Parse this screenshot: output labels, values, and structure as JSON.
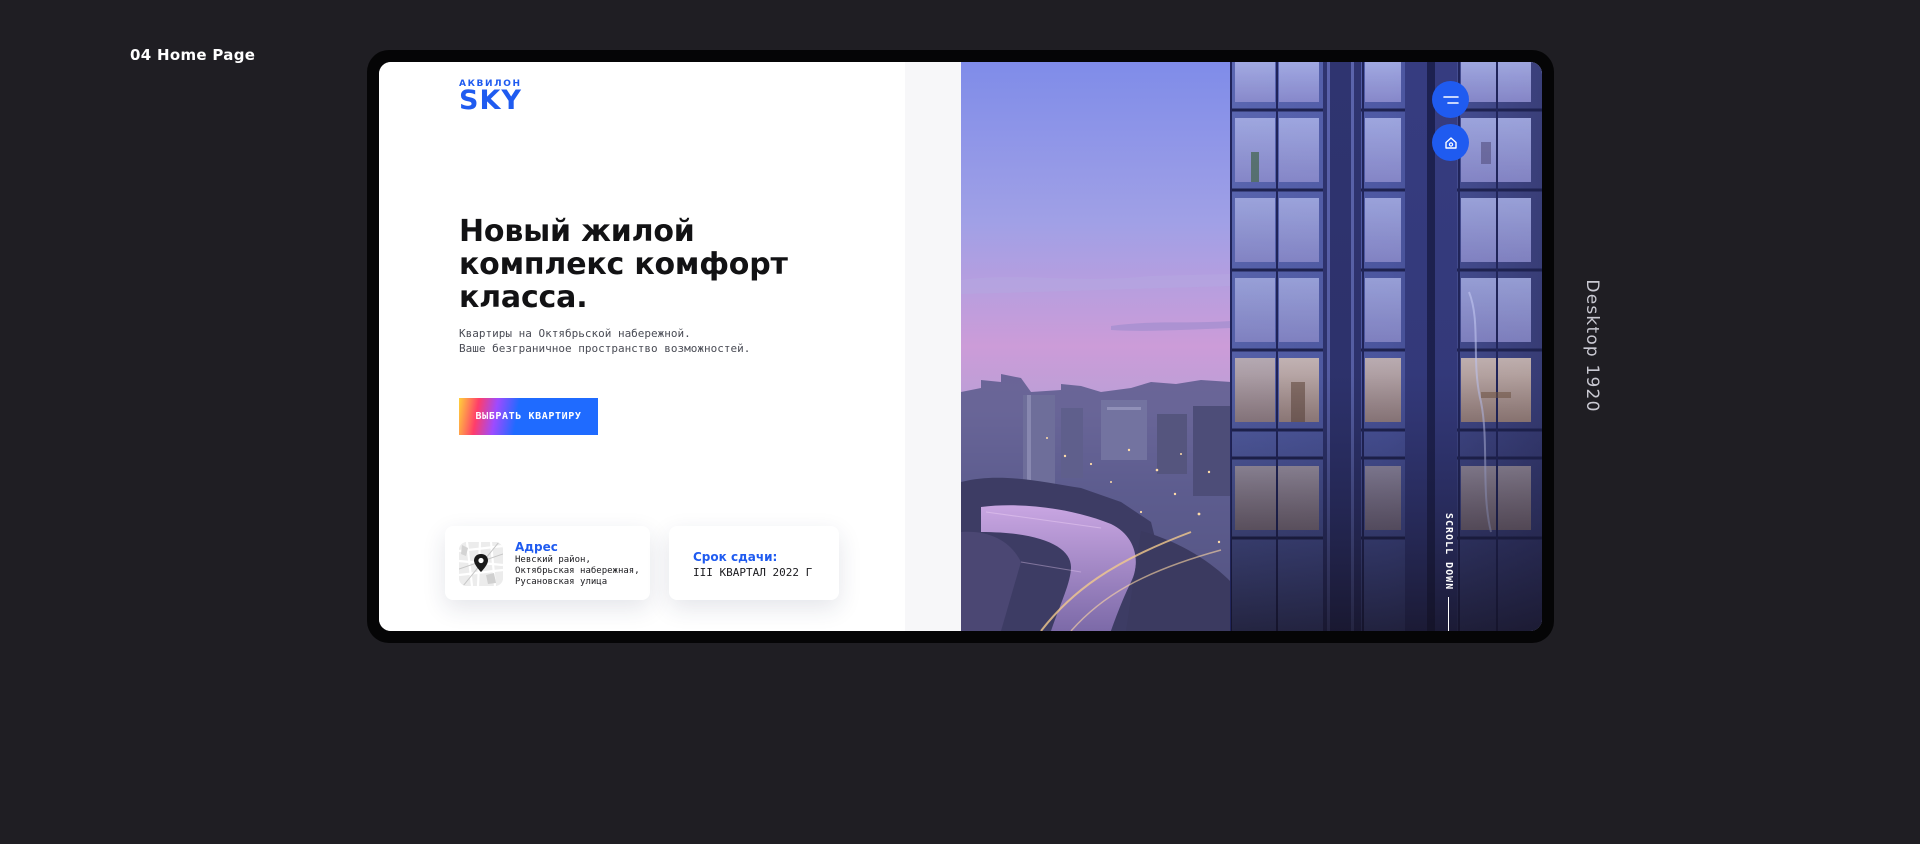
{
  "canvas": {
    "page_label": "04 Home Page",
    "side_label": "Desktop 1920"
  },
  "brand": {
    "top": "АКВИЛОН",
    "main": "SKY",
    "color": "#1f5bf0"
  },
  "hero": {
    "headline": "Новый жилой комплекс комфорт класса.",
    "subtitle_lines": [
      "Квартиры на Октябрьской набережной.",
      "Ваше безграничное пространство возможностей."
    ],
    "cta_label": "ВЫБРАТЬ КВАРТИРУ"
  },
  "cards": {
    "address": {
      "title": "Адрес",
      "lines": [
        "Невский район,",
        "Октябрьская набережная,",
        "Русановская улица"
      ],
      "icon": "map-pin-icon"
    },
    "deadline": {
      "title": "Срок сдачи:",
      "value": "III КВАРТАЛ 2022 Г"
    }
  },
  "nav": {
    "menu_icon": "menu-icon",
    "home_icon": "home-icon",
    "scroll_label": "SCROLL DOWN"
  },
  "colors": {
    "accent": "#1f5bf0",
    "background": "#1f1e23"
  }
}
